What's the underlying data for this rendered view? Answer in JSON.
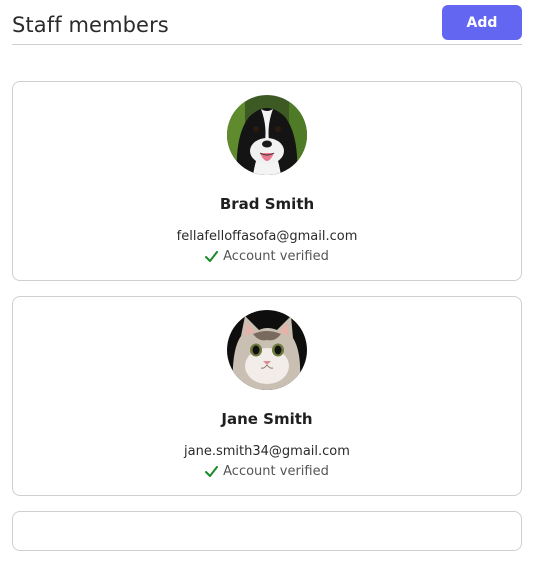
{
  "header": {
    "title": "Staff members",
    "add_label": "Add"
  },
  "colors": {
    "accent": "#6366f1",
    "verified": "#1a8a2b",
    "border": "#cfcfcf"
  },
  "staff": [
    {
      "name": "Brad Smith",
      "email": "fellafelloffasofa@gmail.com",
      "status": "Account verified",
      "avatar": "dog-photo"
    },
    {
      "name": "Jane Smith",
      "email": "jane.smith34@gmail.com",
      "status": "Account verified",
      "avatar": "cat-photo"
    }
  ]
}
